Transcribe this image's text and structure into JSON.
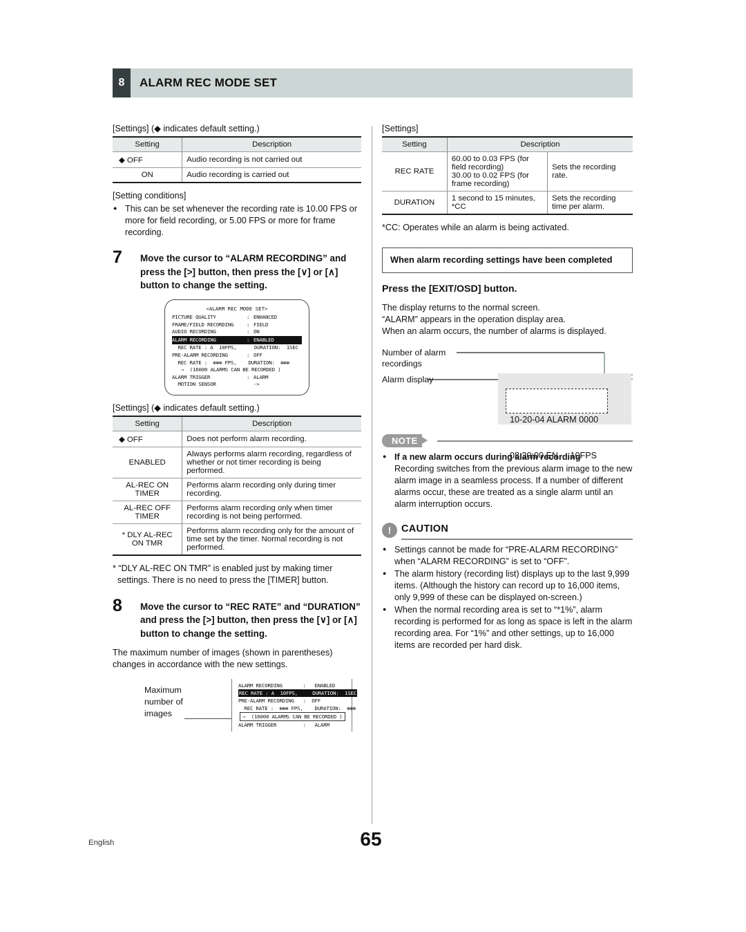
{
  "header": {
    "chapter_number": "8",
    "title": "ALARM REC MODE SET"
  },
  "left_column": {
    "settings_caption_1": "[Settings] (◆ indicates default setting.)",
    "audio_table": {
      "columns": [
        "Setting",
        "Description"
      ],
      "rows": [
        {
          "setting": "◆ OFF",
          "description": "Audio recording is not carried out"
        },
        {
          "setting": "ON",
          "description": "Audio recording is carried out"
        }
      ]
    },
    "conditions_caption": "[Setting conditions]",
    "conditions": [
      "This can be set whenever the recording rate is 10.00 FPS or more for field recording, or 5.00 FPS or more for frame recording."
    ],
    "step7": {
      "number": "7",
      "text": "Move the cursor to “ALARM RECORDING” and press the [>] button, then press the [∨] or [∧] button to change the setting."
    },
    "osd_screen": {
      "title": "<ALARM REC MODE SET>",
      "rows": [
        {
          "label": "PICTURE QUALITY",
          "colon": ":",
          "value": "ENHANCED",
          "highlight": false
        },
        {
          "label": "FRAME/FIELD RECORDING",
          "colon": ":",
          "value": "FIELD",
          "highlight": false
        },
        {
          "label": "AUDIO RECORDING",
          "colon": ":",
          "value": "ON",
          "highlight": false
        },
        {
          "label": "ALARM RECORDING",
          "colon": ":",
          "value": "ENABLED",
          "highlight": true
        }
      ],
      "rec_rate_line_1": "  REC RATE : A  10FPS,      DURATION:  1SEC",
      "pre_alarm_label": "PRE-ALARM RECORDING",
      "pre_alarm_colon": ":",
      "pre_alarm_value": "OFF",
      "rec_rate_line_2": "  REC RATE :  ✻✻✻ FPS,    DURATION:  ✻✻✻",
      "alarms_line": "⇒  (16000 ALARMS CAN BE RECORDED )",
      "alarm_trigger_label": "ALARM TRIGGER",
      "alarm_trigger_colon": ":",
      "alarm_trigger_value": "ALARM",
      "motion_sensor_label": "  MOTION SENSOR",
      "motion_sensor_value": "->"
    },
    "settings_caption_2": "[Settings] (◆ indicates default setting.)",
    "alarm_rec_table": {
      "columns": [
        "Setting",
        "Description"
      ],
      "rows": [
        {
          "setting": "◆ OFF",
          "description": "Does not perform alarm recording."
        },
        {
          "setting": "ENABLED",
          "description": "Always performs alarm recording, regardless of whether or not timer recording is being performed."
        },
        {
          "setting": "AL-REC ON TIMER",
          "description": "Performs alarm recording only during timer recording."
        },
        {
          "setting": "AL-REC OFF TIMER",
          "description": "Performs alarm recording only when timer recording is not being performed."
        },
        {
          "setting": "* DLY AL-REC ON TMR",
          "description": "Performs alarm recording only for the amount of time set by the timer. Normal recording is not performed."
        }
      ]
    },
    "footnote_star": "* “DLY AL-REC ON TMR” is enabled just by making timer settings. There is no need to press the [TIMER] button.",
    "step8": {
      "number": "8",
      "text": "Move the cursor to “REC RATE” and “DURATION” and press the [>] button, then press the [∨] or [∧] button to change the setting."
    },
    "step8_body": "The maximum number of images (shown in parentheses) changes in accordance with the new settings.",
    "max_images_callout": "Maximum number of images",
    "osd_screen_2": {
      "line1": "ALARM RECORDING       :   ENABLED",
      "line2_highlight": "REC RATE : A  10FPS,     DURATION:  1SEC",
      "line3": "PRE-ALARM RECORDING   :  OFF",
      "line4": "  REC RATE :  ✻✻✻ FPS,    DURATION:  ✻✻✻",
      "line5_boxed": "⇒  (16000 ALARMS CAN BE RECORDED )",
      "line6": "ALARM TRIGGER         :   ALARM"
    }
  },
  "right_column": {
    "settings_caption": "[Settings]",
    "rec_table": {
      "columns": [
        "Setting",
        "Description"
      ],
      "rows": [
        {
          "setting": "REC RATE",
          "description_1": "60.00 to 0.03 FPS (for field recording)\n30.00 to 0.02 FPS (for frame recording)",
          "description_2": "Sets the recording rate."
        },
        {
          "setting": "DURATION",
          "description_1": "1 second to 15 minutes, *CC",
          "description_2": "Sets the recording time per alarm."
        }
      ]
    },
    "cc_footnote": "*CC: Operates while an alarm is being activated.",
    "completed_box": "When alarm recording settings have been completed",
    "press_exit": "Press the [EXIT/OSD] button.",
    "exit_body": [
      "The display returns to the normal screen.",
      "“ALARM” appears in the operation display area.",
      "When an alarm occurs, the number of alarms is displayed."
    ],
    "alarm_figure": {
      "label_number": "Number of alarm recordings",
      "label_display": "Alarm display",
      "osd_line_1": "10-20-04 ALARM 0000",
      "osd_line_2": "08:30:00 EN     10FPS"
    },
    "note": {
      "tag": "NOTE",
      "heading": "If a new alarm occurs during alarm recording",
      "body": "Recording switches from the previous alarm image to the new alarm image in a seamless process. If a number of different alarms occur, these are treated as a single alarm until an alarm interruption occurs."
    },
    "caution": {
      "tag": "CAUTION",
      "items": [
        "Settings cannot be made for “PRE-ALARM RECORDING” when “ALARM RECORDING” is set to “OFF”.",
        "The alarm history (recording list) displays up to the last 9,999 items. (Although the history can record up to 16,000 items, only 9,999 of these can be displayed on-screen.)",
        "When the normal recording area is set to “*1%”, alarm recording is performed for as long as space is left in the alarm recording area. For “1%” and other settings, up to 16,000 items are recorded per hard disk."
      ]
    }
  },
  "footer": {
    "language": "English",
    "page_number": "65"
  },
  "colors": {
    "header_bar": "#ccd6d4",
    "header_number_box": "#353f3f",
    "table_head": "#e6eaea",
    "note_tag": "#9b9b9b",
    "caution_circle": "#8f8f8f"
  }
}
